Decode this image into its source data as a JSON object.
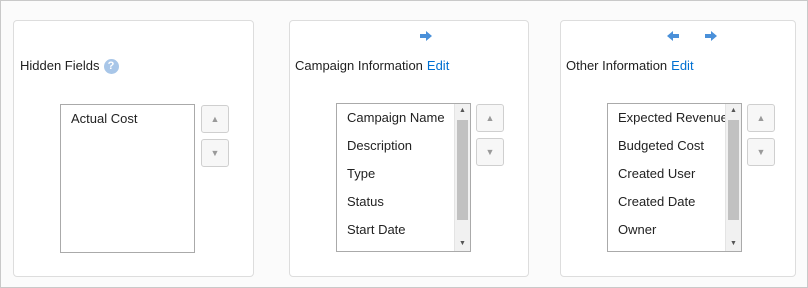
{
  "colors": {
    "accent": "#4a90d9",
    "link": "#0070d2",
    "panel_border": "#dddddd"
  },
  "icons": {
    "move_right": "arrow-right-icon",
    "move_left": "arrow-left-icon",
    "move_up": "triangle-up-icon",
    "move_down": "triangle-down-icon",
    "help": "help-icon"
  },
  "hidden_fields": {
    "title": "Hidden Fields",
    "help_glyph": "?",
    "items": [
      "Actual Cost"
    ]
  },
  "campaign_information": {
    "title": "Campaign Information",
    "edit_label": "Edit",
    "items": [
      "Campaign Name",
      "Description",
      "Type",
      "Status",
      "Start Date"
    ]
  },
  "other_information": {
    "title": "Other Information",
    "edit_label": "Edit",
    "items": [
      "Expected Revenue",
      "Budgeted Cost",
      "Created User",
      "Created Date",
      "Owner"
    ]
  }
}
